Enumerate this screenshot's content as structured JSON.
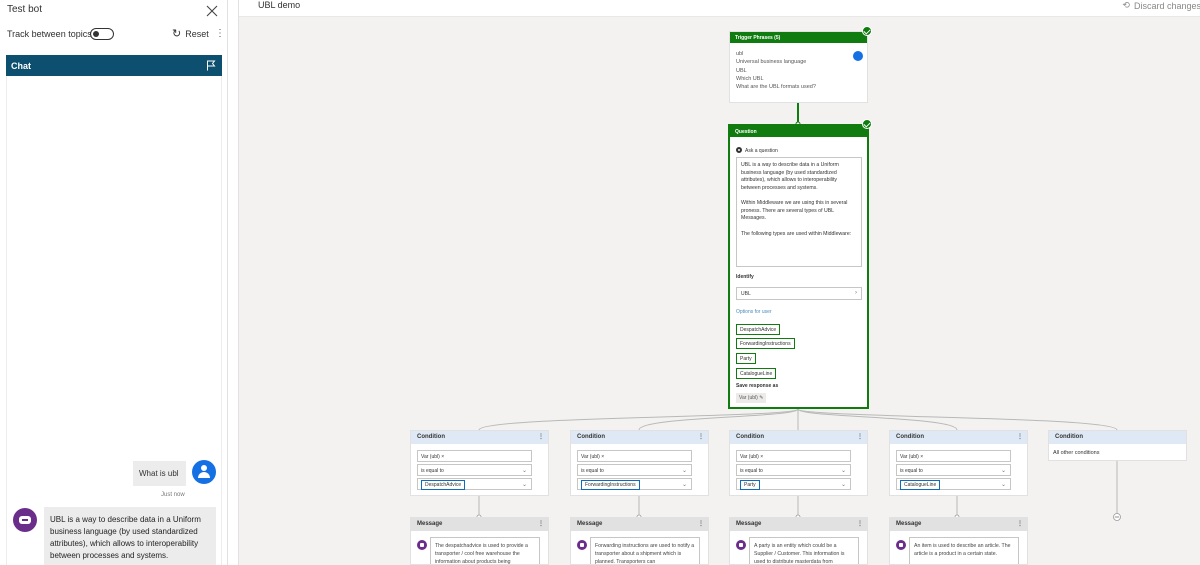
{
  "testbot": {
    "title": "Test bot",
    "track_label": "Track between topics",
    "reset_label": "Reset",
    "chat_label": "Chat",
    "user_message": "What is ubl",
    "timestamp": "Just now",
    "bot_message": "UBL is a way to describe data in a Uniform business language (by used standardized attributes), which allows to interoperability between processes and systems."
  },
  "canvas": {
    "topic_name": "UBL demo",
    "discard_label": "Discard changes"
  },
  "trigger": {
    "title": "Trigger Phrases (5)",
    "phrases": [
      "ubl",
      "Universal business language",
      "UBL",
      "Which UBL",
      "What are the UBL formats used?"
    ]
  },
  "question": {
    "title": "Question",
    "ask_label": "Ask a question",
    "text_p1": "UBL is a way to describe data in a Uniform business language (by used standardized attributes), which allows to interoperability between processes and systems.",
    "text_p2": "Within Middleware we are using this in several proness. There are several types of UBL Messages.",
    "text_p3": "The following types are used within Middleware:",
    "identify_label": "Identify",
    "identify_value": "UBL",
    "options_label": "Options for user",
    "options": [
      "DespatchAdvice",
      "ForwardingInstructions",
      "Party",
      "CatalogueLine"
    ],
    "save_label": "Save response as",
    "save_var": "Var (ubl)"
  },
  "conditions": [
    {
      "title": "Condition",
      "var": "Var (ubl)",
      "op": "is equal to",
      "value": "DespatchAdvice"
    },
    {
      "title": "Condition",
      "var": "Var (ubl)",
      "op": "is equal to",
      "value": "ForwardingInstructions"
    },
    {
      "title": "Condition",
      "var": "Var (ubl)",
      "op": "is equal to",
      "value": "Party"
    },
    {
      "title": "Condition",
      "var": "Var (ubl)",
      "op": "is equal to",
      "value": "CatalogueLine"
    }
  ],
  "condition_other": {
    "title": "Condition",
    "body": "All other conditions"
  },
  "messages": [
    {
      "title": "Message",
      "text": "The despatchadvice is used to provide a transporter / cool free warehouse the information about products being"
    },
    {
      "title": "Message",
      "text": "Forwarding instructions are used to notify a transporter about a shipment which is planned. Transporters can"
    },
    {
      "title": "Message",
      "text": "A party is an entity which could be a Supplier / Customer. This information is used to distribute masterdata from"
    },
    {
      "title": "Message",
      "text": "An item is used to describe an article. The article is a product in a certain state."
    }
  ],
  "colors": {
    "chat_header": "#0d4f6e",
    "node_green": "#107c10",
    "condition_header": "#dfe9f5",
    "bot_purple": "#6b2d8a",
    "user_blue": "#1570e3"
  }
}
